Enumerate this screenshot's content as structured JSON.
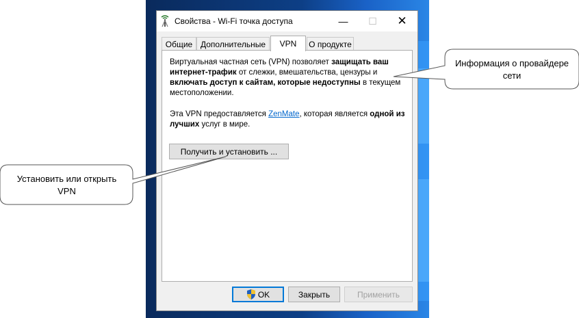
{
  "dialog": {
    "title": "Свойства - Wi-Fi точка доступа",
    "window_buttons": {
      "minimize": "—",
      "maximize": "☐",
      "close": "✕"
    },
    "tabs": [
      {
        "label": "Общие",
        "active": false
      },
      {
        "label": "Дополнительные",
        "active": false
      },
      {
        "label": "VPN",
        "active": true
      },
      {
        "label": "О продукте",
        "active": false
      }
    ],
    "vpn_panel": {
      "paragraph1": {
        "p1": "Виртуальная частная сеть (VPN) позволяет ",
        "b1": "защищать ваш интернет-трафик",
        "p2": " от слежки, вмешательства, цензуры и ",
        "b2": "включать доступ к сайтам, которые недоступны",
        "p3": " в текущем местоположении."
      },
      "paragraph2": {
        "p1": "Эта VPN предоставляется ",
        "link": "ZenMate",
        "p2": ", которая является ",
        "b1": "одной из лучших",
        "p3": " услуг в мире."
      },
      "install_button": "Получить и установить ..."
    },
    "footer_buttons": {
      "ok": "OK",
      "close": "Закрыть",
      "apply": "Применить"
    }
  },
  "callouts": {
    "provider_info": "Информация о провайдере сети",
    "install_vpn": "Установить или открыть VPN"
  },
  "colors": {
    "accent": "#0078d7",
    "link": "#0066cc",
    "desktop": "#0d3f86"
  },
  "icons": {
    "title": "wifi-antenna-icon",
    "ok": "uac-shield-icon"
  }
}
